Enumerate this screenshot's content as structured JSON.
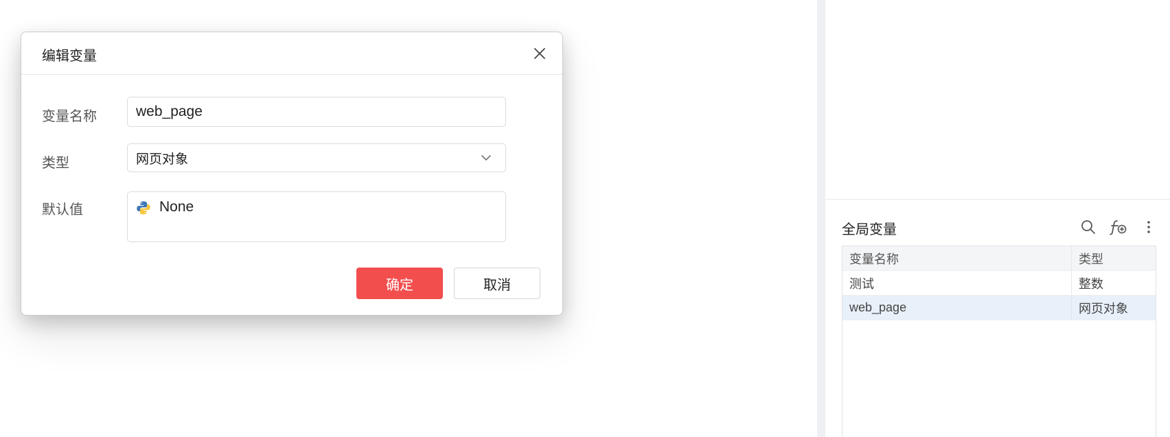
{
  "dialog": {
    "title": "编辑变量",
    "name_label": "变量名称",
    "name_value": "web_page",
    "type_label": "类型",
    "type_value": "网页对象",
    "default_label": "默认值",
    "default_value": "None",
    "default_icon": "python-icon",
    "ok_label": "确定",
    "cancel_label": "取消"
  },
  "global_vars": {
    "title": "全局变量",
    "tools": [
      "search-icon",
      "add-function-icon",
      "more-vertical-icon"
    ],
    "columns": [
      "变量名称",
      "类型"
    ],
    "rows": [
      {
        "name": "测试",
        "type": "整数"
      },
      {
        "name": "web_page",
        "type": "网页对象"
      }
    ],
    "selected_row_color": "#e8f0fa"
  },
  "colors": {
    "primary": "#f24e4e"
  }
}
